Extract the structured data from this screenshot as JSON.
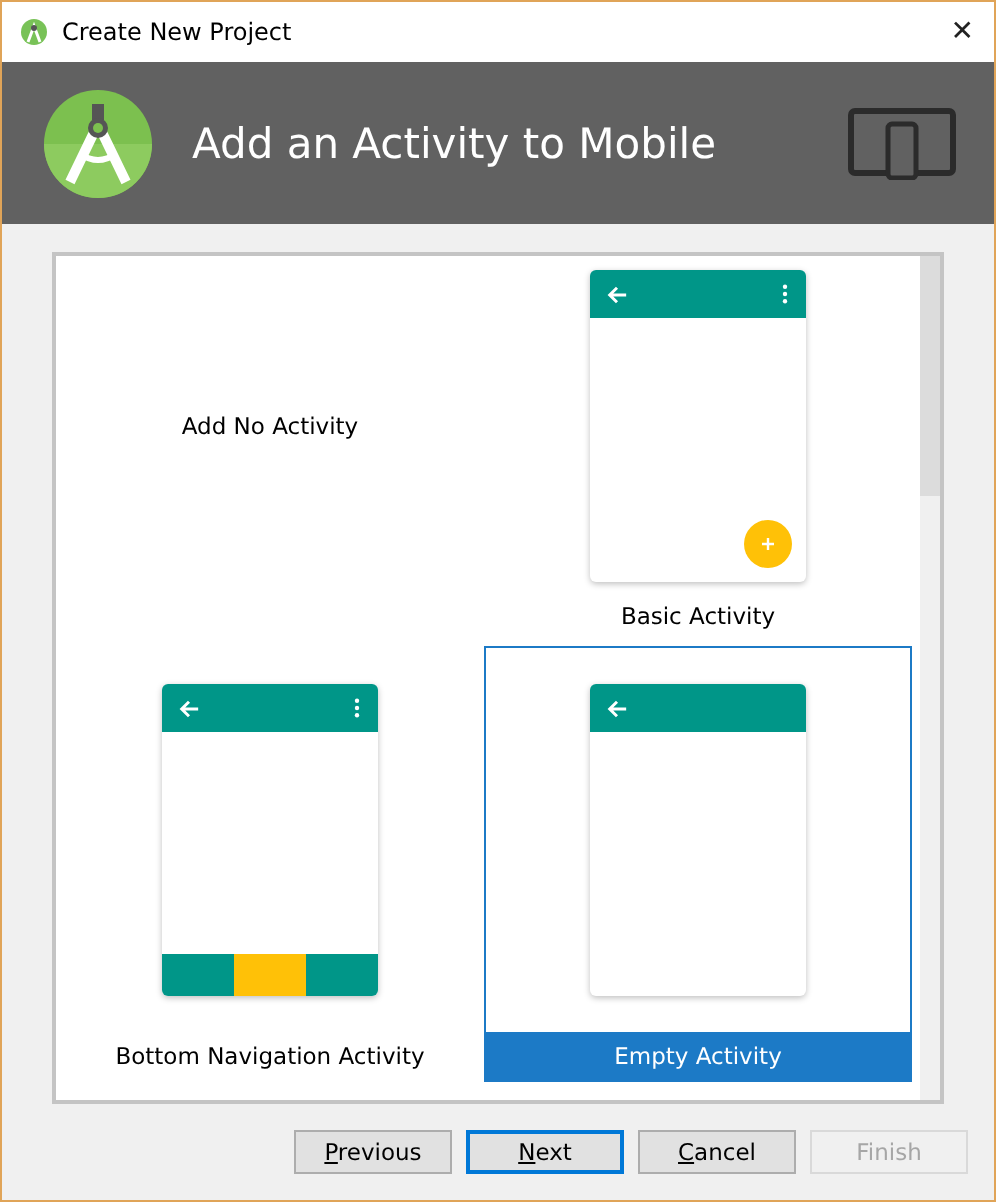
{
  "window": {
    "title": "Create New Project",
    "close": "✕"
  },
  "header": {
    "title": "Add an Activity to Mobile"
  },
  "templates": [
    {
      "kind": "none",
      "label": "Add No Activity",
      "selected": false
    },
    {
      "kind": "basic",
      "label": "Basic Activity",
      "selected": false
    },
    {
      "kind": "bottom_nav",
      "label": "Bottom Navigation Activity",
      "selected": false
    },
    {
      "kind": "empty",
      "label": "Empty Activity",
      "selected": true
    }
  ],
  "buttons": [
    {
      "label": "Previous",
      "mnemonic": true,
      "disabled": false,
      "default": false
    },
    {
      "label": "Next",
      "mnemonic": true,
      "disabled": false,
      "default": true
    },
    {
      "label": "Cancel",
      "mnemonic": true,
      "disabled": false,
      "default": false
    },
    {
      "label": "Finish",
      "mnemonic": false,
      "disabled": true,
      "default": false
    }
  ]
}
